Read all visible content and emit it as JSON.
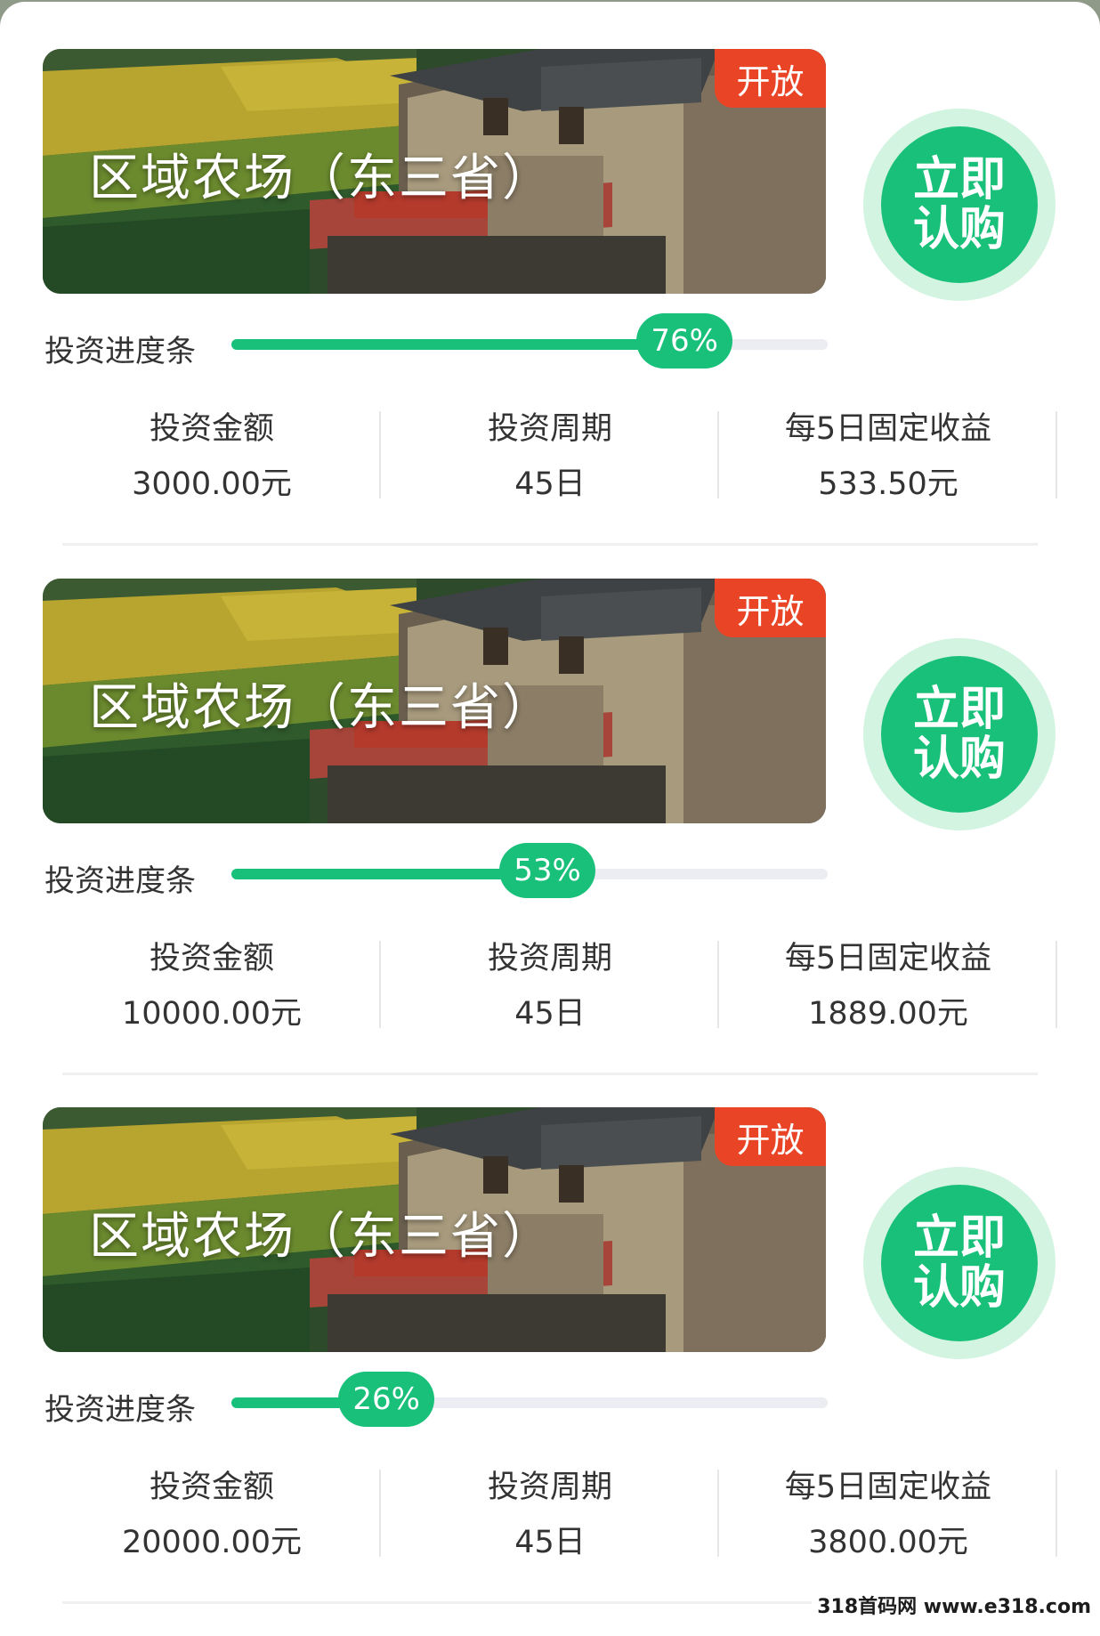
{
  "products": [
    {
      "title": "区域农场（东三省）",
      "status_tag": "开放",
      "buy_label": "立即认购",
      "progress_label": "投资进度条",
      "progress_percent": 76,
      "progress_text": "76%",
      "stats": [
        {
          "label": "投资金额",
          "value": "3000.00元"
        },
        {
          "label": "投资周期",
          "value": "45日"
        },
        {
          "label": "每5日固定收益",
          "value": "533.50元"
        }
      ]
    },
    {
      "title": "区域农场（东三省）",
      "status_tag": "开放",
      "buy_label": "立即认购",
      "progress_label": "投资进度条",
      "progress_percent": 53,
      "progress_text": "53%",
      "stats": [
        {
          "label": "投资金额",
          "value": "10000.00元"
        },
        {
          "label": "投资周期",
          "value": "45日"
        },
        {
          "label": "每5日固定收益",
          "value": "1889.00元"
        }
      ]
    },
    {
      "title": "区域农场（东三省）",
      "status_tag": "开放",
      "buy_label": "立即认购",
      "progress_label": "投资进度条",
      "progress_percent": 26,
      "progress_text": "26%",
      "stats": [
        {
          "label": "投资金额",
          "value": "20000.00元"
        },
        {
          "label": "投资周期",
          "value": "45日"
        },
        {
          "label": "每5日固定收益",
          "value": "3800.00元"
        }
      ]
    }
  ],
  "watermark": "318首码网 www.e318.com",
  "colors": {
    "accent": "#19c07a",
    "accent_light": "#d4f4e2",
    "tag": "#ea4426",
    "track": "#ecedf2"
  },
  "icons": {
    "banner": "farmhouse-photo"
  }
}
